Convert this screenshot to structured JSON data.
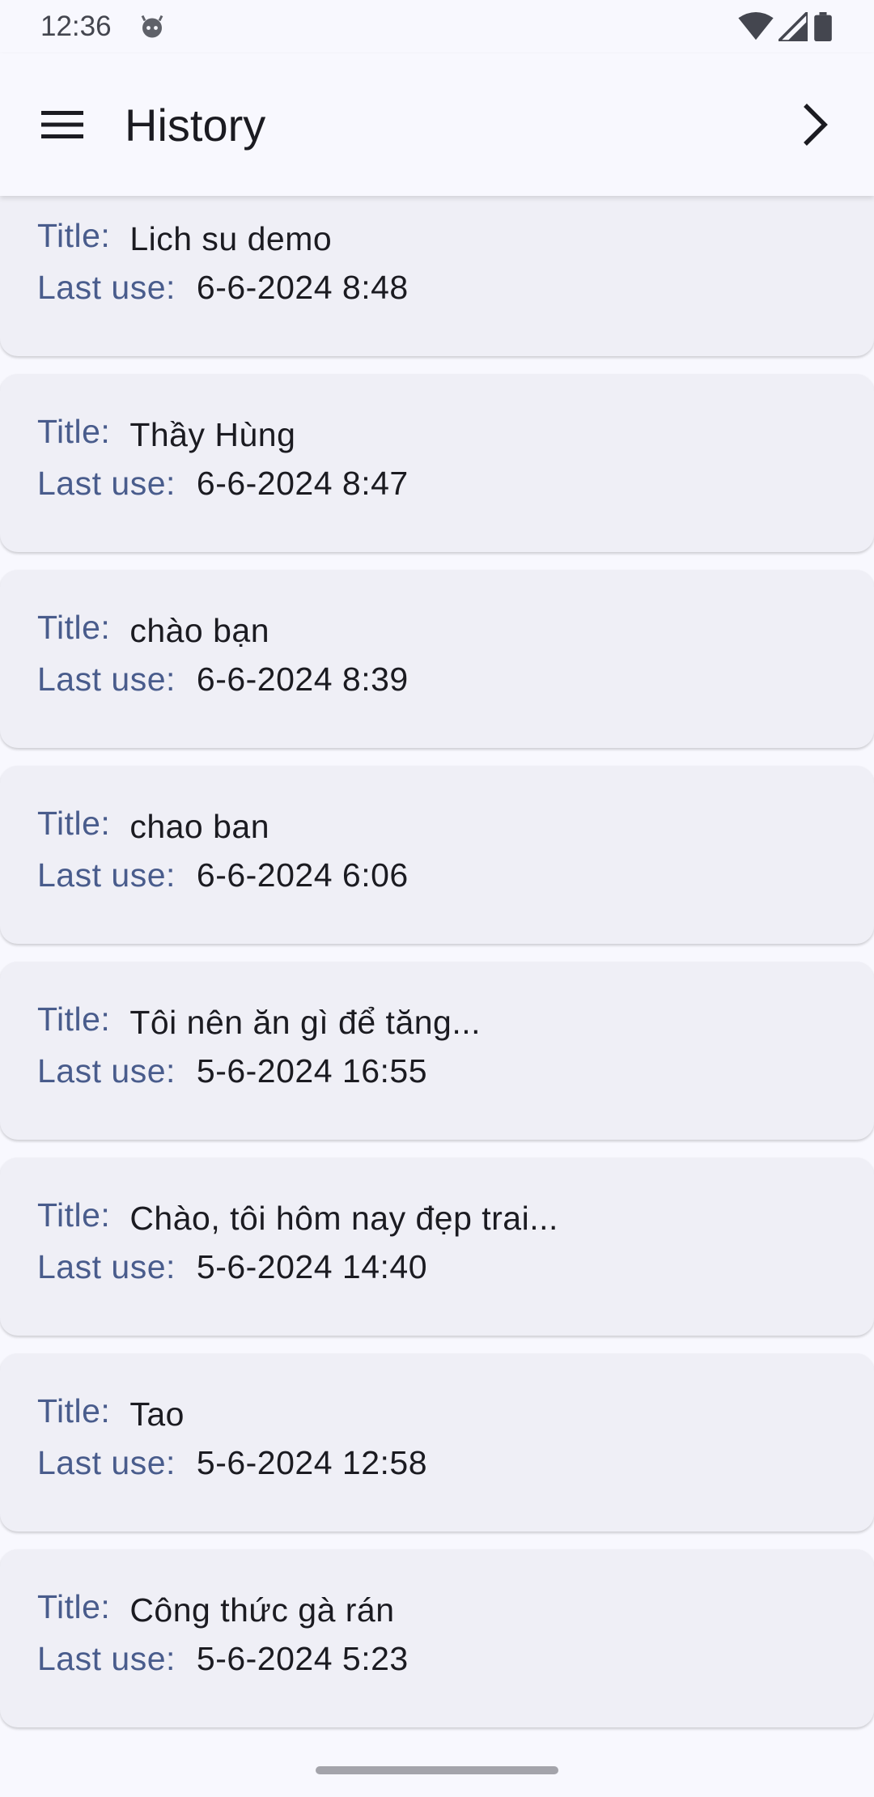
{
  "status_bar": {
    "time": "12:36"
  },
  "app_bar": {
    "title": "History"
  },
  "labels": {
    "title": "Title:",
    "last_use": "Last use:"
  },
  "history": [
    {
      "title": "Lich su demo",
      "last_use": "6-6-2024 8:48"
    },
    {
      "title": "Thầy Hùng",
      "last_use": "6-6-2024 8:47"
    },
    {
      "title": "chào bạn",
      "last_use": "6-6-2024 8:39"
    },
    {
      "title": "chao ban",
      "last_use": "6-6-2024 6:06"
    },
    {
      "title": "Tôi nên ăn gì để tăng...",
      "last_use": "5-6-2024 16:55"
    },
    {
      "title": "Chào, tôi hôm nay đẹp trai...",
      "last_use": "5-6-2024 14:40"
    },
    {
      "title": "Tao",
      "last_use": "5-6-2024 12:58"
    },
    {
      "title": "Công thức gà rán",
      "last_use": "5-6-2024 5:23"
    }
  ],
  "colors": {
    "label": "#495c8c",
    "card": "#efeff6",
    "background": "#f8f8fe"
  },
  "icons": {
    "menu": "hamburger-icon",
    "next": "chevron-right-icon"
  }
}
